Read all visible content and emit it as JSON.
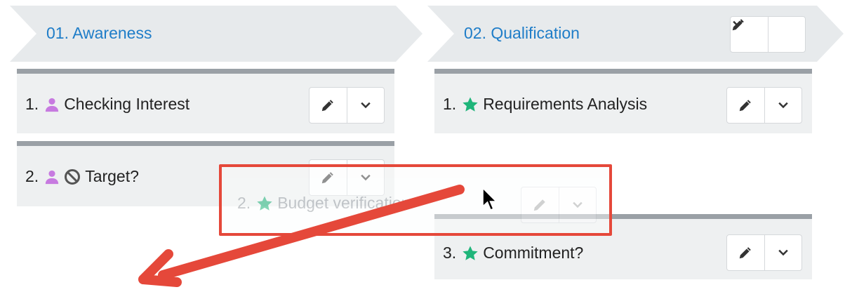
{
  "stages": [
    {
      "title": "01. Awareness"
    },
    {
      "title": "02. Qualification"
    }
  ],
  "cards": {
    "checking_interest": {
      "num": "1.",
      "label": "Checking Interest"
    },
    "target": {
      "num": "2.",
      "label": "Target?"
    },
    "requirements": {
      "num": "1.",
      "label": "Requirements Analysis"
    },
    "commitment": {
      "num": "3.",
      "label": "Commitment?"
    }
  },
  "dragged_card": {
    "num": "2.",
    "label": "Budget verification"
  },
  "icons": {
    "person": "person-icon",
    "star": "star-icon",
    "blocked": "blocked-icon",
    "edit": "pencil-icon",
    "expand": "chevron-down-icon"
  },
  "colors": {
    "stage_title": "#1f7dc8",
    "person": "#c77ae0",
    "star": "#1fb57a",
    "highlight": "#e5483a"
  }
}
